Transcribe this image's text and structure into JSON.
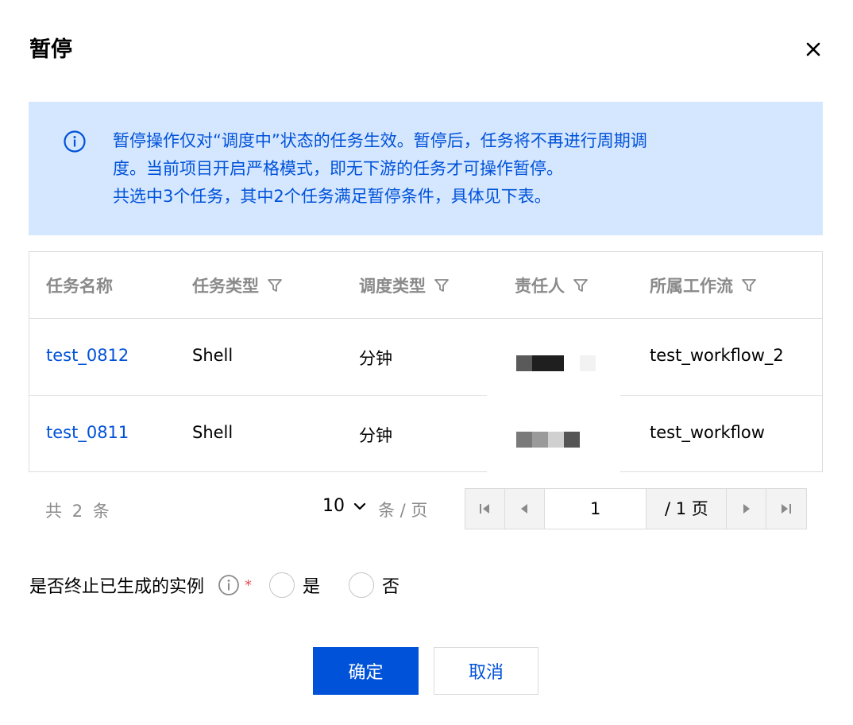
{
  "dialog": {
    "title": "暂停",
    "close_icon": "close-icon"
  },
  "notice": {
    "icon": "info-icon",
    "lines": [
      "暂停操作仅对“调度中”状态的任务生效。暂停后，任务将不再进行周期调",
      "度。当前项目开启严格模式，即无下游的任务才可操作暂停。",
      "共选中3个任务，其中2个任务满足暂停条件，具体见下表。"
    ]
  },
  "table": {
    "columns": [
      "任务名称",
      "任务类型",
      "调度类型",
      "责任人",
      "所属工作流"
    ],
    "filter_icon": "filter-icon",
    "rows": [
      {
        "name": "test_0812",
        "type": "Shell",
        "schedule": "分钟",
        "owner": "",
        "workflow": "test_workflow_2"
      },
      {
        "name": "test_0811",
        "type": "Shell",
        "schedule": "分钟",
        "owner": "",
        "workflow": "test_workflow"
      }
    ]
  },
  "pagination": {
    "total_prefix": "共",
    "total": "2",
    "total_suffix": "条",
    "page_size": "10",
    "per_page_label": "条 / 页",
    "current_page": "1",
    "total_pages_label": "/ 1 页"
  },
  "form": {
    "label": "是否终止已生成的实例",
    "required_mark": "*",
    "options": [
      "是",
      "否"
    ]
  },
  "buttons": {
    "confirm": "确定",
    "cancel": "取消"
  },
  "colors": {
    "primary": "#0052d9",
    "notice_bg": "#d5e7ff"
  }
}
